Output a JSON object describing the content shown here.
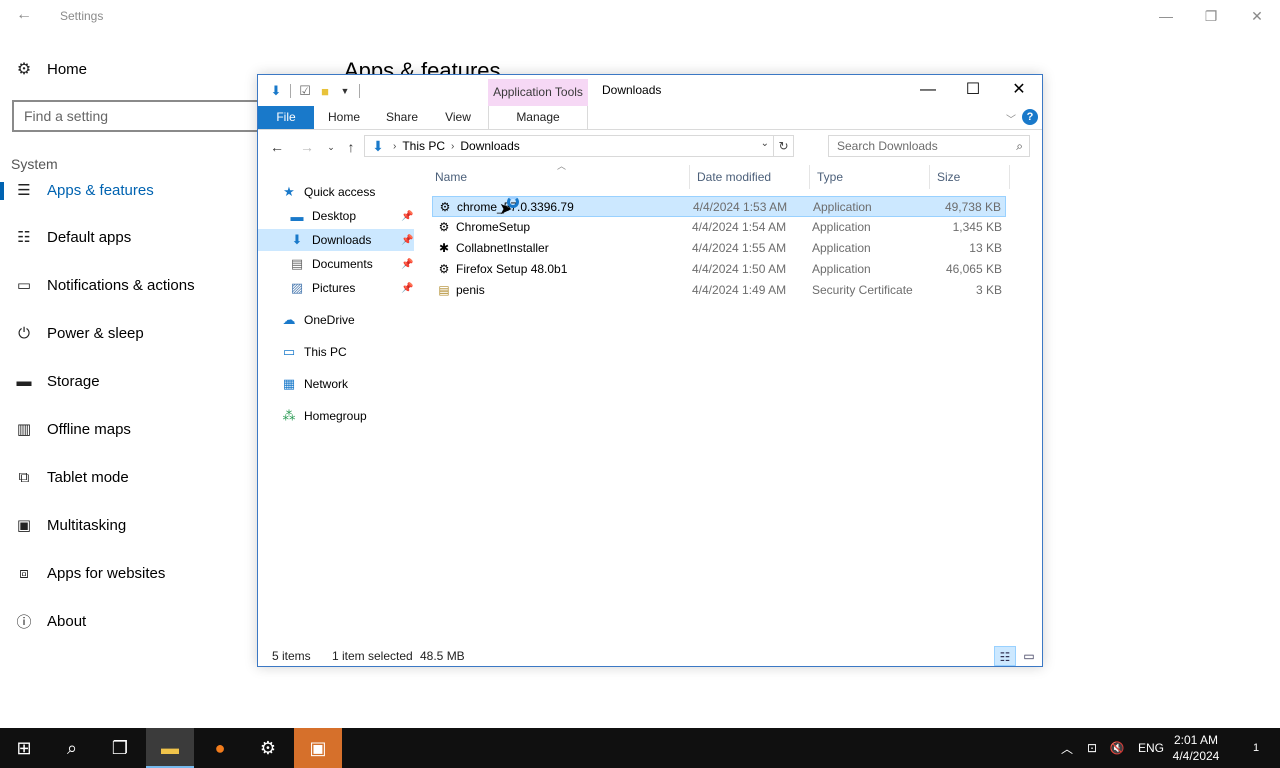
{
  "settings": {
    "title": "Settings",
    "home_label": "Home",
    "search_placeholder": "Find a setting",
    "group_label": "System",
    "page_heading": "Apps & features",
    "items": [
      {
        "label": "Apps & features",
        "icon": "apps-list-icon"
      },
      {
        "label": "Default apps",
        "icon": "default-apps-icon"
      },
      {
        "label": "Notifications & actions",
        "icon": "notifications-icon"
      },
      {
        "label": "Power & sleep",
        "icon": "power-icon"
      },
      {
        "label": "Storage",
        "icon": "storage-icon"
      },
      {
        "label": "Offline maps",
        "icon": "map-icon"
      },
      {
        "label": "Tablet mode",
        "icon": "tablet-icon"
      },
      {
        "label": "Multitasking",
        "icon": "multitasking-icon"
      },
      {
        "label": "Apps for websites",
        "icon": "web-apps-icon"
      },
      {
        "label": "About",
        "icon": "info-icon"
      }
    ]
  },
  "explorer": {
    "title": "Downloads",
    "context_tab_group": "Application Tools",
    "ribbon_tabs": [
      "File",
      "Home",
      "Share",
      "View",
      "Manage"
    ],
    "address": {
      "crumbs": [
        "This PC",
        "Downloads"
      ]
    },
    "search_placeholder": "Search Downloads",
    "nav_pane": [
      {
        "label": "Quick access",
        "icon": "star-icon"
      },
      {
        "label": "Desktop",
        "icon": "desktop-icon",
        "pinned": true
      },
      {
        "label": "Downloads",
        "icon": "downloads-icon",
        "pinned": true,
        "selected": true
      },
      {
        "label": "Documents",
        "icon": "documents-icon",
        "pinned": true
      },
      {
        "label": "Pictures",
        "icon": "pictures-icon",
        "pinned": true
      },
      {
        "label": "OneDrive",
        "icon": "cloud-icon"
      },
      {
        "label": "This PC",
        "icon": "computer-icon"
      },
      {
        "label": "Network",
        "icon": "network-icon"
      },
      {
        "label": "Homegroup",
        "icon": "homegroup-icon"
      }
    ],
    "columns": [
      "Name",
      "Date modified",
      "Type",
      "Size"
    ],
    "files": [
      {
        "name": "chrome_57.0.3396.79",
        "date": "4/4/2024 1:53 AM",
        "type": "Application",
        "size": "49,738 KB",
        "selected": true
      },
      {
        "name": "ChromeSetup",
        "date": "4/4/2024 1:54 AM",
        "type": "Application",
        "size": "1,345 KB"
      },
      {
        "name": "CollabnetInstaller",
        "date": "4/4/2024 1:55 AM",
        "type": "Application",
        "size": "13 KB"
      },
      {
        "name": "Firefox Setup 48.0b1",
        "date": "4/4/2024 1:50 AM",
        "type": "Application",
        "size": "46,065 KB"
      },
      {
        "name": "penis",
        "date": "4/4/2024 1:49 AM",
        "type": "Security Certificate",
        "size": "3 KB"
      }
    ],
    "status": {
      "count": "5 items",
      "selection": "1 item selected",
      "size": "48.5 MB"
    }
  },
  "taskbar": {
    "language": "ENG",
    "time": "2:01 AM",
    "date": "4/4/2024",
    "notification_count": "1"
  },
  "colors": {
    "accent": "#1979ca",
    "selection": "#cce8ff",
    "settings_accent": "#0063b1",
    "taskbar": "#101010"
  }
}
